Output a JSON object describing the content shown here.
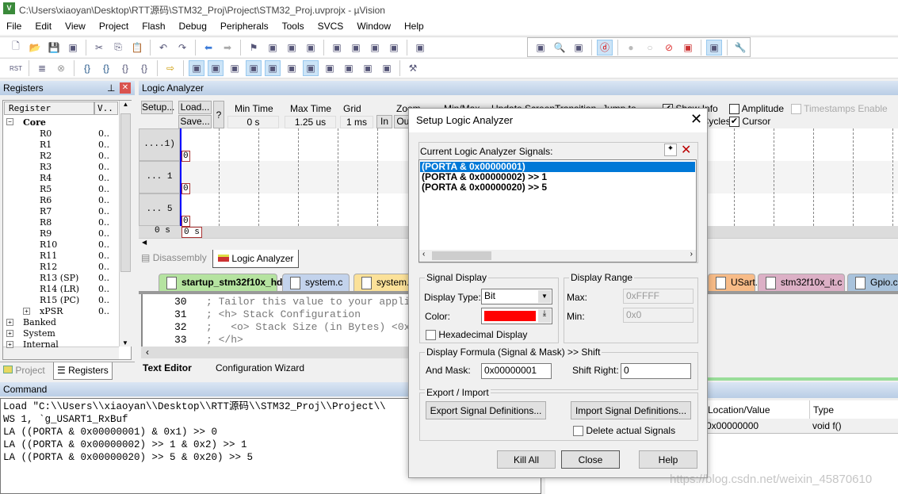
{
  "window": {
    "title": "C:\\Users\\xiaoyan\\Desktop\\RTT源码\\STM32_Proj\\Project\\STM32_Proj.uvprojx - µVision",
    "app_icon": "uvision-logo"
  },
  "menu": [
    "File",
    "Edit",
    "View",
    "Project",
    "Flash",
    "Debug",
    "Peripherals",
    "Tools",
    "SVCS",
    "Window",
    "Help"
  ],
  "toolbar1": [
    "new-file-icon",
    "open-icon",
    "save-icon",
    "save-all-icon",
    "|",
    "cut-icon",
    "copy-icon",
    "paste-icon",
    "|",
    "undo-icon",
    "redo-icon",
    "|",
    "nav-back-icon",
    "nav-forward-icon",
    "|",
    "bookmark-icon",
    "prev-bookmark-icon",
    "next-bookmark-icon",
    "clear-bookmarks-icon",
    "|",
    "indent-icon",
    "unindent-icon",
    "comment-icon",
    "uncomment-icon",
    "|",
    "find-in-files-icon"
  ],
  "toolbar1_right": [
    "find-combo-icon",
    "find-icon",
    "incremental-find-icon",
    "|",
    "debug-session-icon*",
    "|",
    "breakpoint-icon",
    "disable-breakpoint-icon",
    "kill-breakpoints-icon",
    "kill-all-icon",
    "|",
    "window-layout-icon*",
    "|",
    "configure-icon"
  ],
  "toolbar2": [
    "reset-icon",
    "|",
    "run-icon",
    "stop-icon",
    "|",
    "step-into-icon",
    "step-over-icon",
    "step-out-icon",
    "run-to-cursor-icon",
    "|",
    "show-next-statement-icon",
    "|",
    "command-window-icon*",
    "disassembly-window-icon*",
    "symbols-window-icon",
    "registers-window-icon*",
    "call-stack-window-icon*",
    "watch-window-icon",
    "memory-window-icon*",
    "serial-window-icon",
    "analysis-window-icon",
    "trace-window-icon",
    "system-viewer-icon",
    "|",
    "toolbox-icon"
  ],
  "registers": {
    "title": "Registers",
    "col_register": "Register",
    "col_value": "V..",
    "groups": {
      "core": "Core",
      "banked": "Banked",
      "system": "System",
      "internal": "Internal"
    },
    "items": [
      {
        "n": "R0",
        "v": "0.."
      },
      {
        "n": "R1",
        "v": "0.."
      },
      {
        "n": "R2",
        "v": "0.."
      },
      {
        "n": "R3",
        "v": "0.."
      },
      {
        "n": "R4",
        "v": "0.."
      },
      {
        "n": "R5",
        "v": "0.."
      },
      {
        "n": "R6",
        "v": "0.."
      },
      {
        "n": "R7",
        "v": "0.."
      },
      {
        "n": "R8",
        "v": "0.."
      },
      {
        "n": "R9",
        "v": "0.."
      },
      {
        "n": "R10",
        "v": "0.."
      },
      {
        "n": "R11",
        "v": "0.."
      },
      {
        "n": "R12",
        "v": "0.."
      },
      {
        "n": "R13 (SP)",
        "v": "0.."
      },
      {
        "n": "R14 (LR)",
        "v": "0.."
      },
      {
        "n": "R15 (PC)",
        "v": "0.."
      },
      {
        "n": "xPSR",
        "v": "0.."
      }
    ],
    "tabs": [
      "Project",
      "Registers"
    ]
  },
  "la": {
    "title": "Logic Analyzer",
    "setup": "Setup...",
    "load": "Load...",
    "save": "Save...",
    "help": "?",
    "min_time_label": "Min Time",
    "min_time": "0 s",
    "max_time_label": "Max Time",
    "max_time": "1.25 us",
    "grid_label": "Grid",
    "grid": "1 ms",
    "zoom_label": "Zoom",
    "zoom_in": "In",
    "zoom_out": "Out",
    "minmax_label": "Min/Max",
    "update_label": "Update Screen",
    "transition_label": "Transition",
    "jump_label": "Jump to",
    "show_info": "Show Info",
    "show_cycles": "Show Cycles",
    "amplitude": "Amplitude",
    "timestamps": "Timestamps Enable",
    "cursor": "Cursor",
    "signals": [
      {
        "label": "....1)",
        "value": "0"
      },
      {
        "label": "... 1",
        "value": "0"
      },
      {
        "label": "... 5",
        "value": "0"
      }
    ],
    "time_left": "0 s",
    "time_cursor": "0 s"
  },
  "view_tabs": [
    "Disassembly",
    "Logic Analyzer"
  ],
  "editor": {
    "tabs": [
      "startup_stm32f10x_hd.s",
      "system.c",
      "system.h",
      "USart.c",
      "stm32f10x_it.c",
      "Gpio.c"
    ],
    "tab_colors": [
      "#b5e3a0",
      "#c3d3ec",
      "#fbe199",
      "#f7bb87",
      "#dcb0c6",
      "#a9c3dc"
    ],
    "lines": [
      {
        "n": "30",
        "t": "; Tailor this value to your appli"
      },
      {
        "n": "31",
        "t": "; <h> Stack Configuration"
      },
      {
        "n": "32",
        "t": ";   <o> Stack Size (in Bytes) <0x"
      },
      {
        "n": "33",
        "t": "; </h>"
      }
    ],
    "bottom_tabs": [
      "Text Editor",
      "Configuration Wizard"
    ]
  },
  "command": {
    "title": "Command",
    "lines": [
      "Load \"C:\\\\Users\\\\xiaoyan\\\\Desktop\\\\RTT源码\\\\STM32_Proj\\\\Project\\\\",
      "WS 1, `g_USART1_RxBuf",
      "LA ((PORTA & 0x00000001) & 0x1) >> 0",
      "LA ((PORTA & 0x00000002) >> 1 & 0x2) >> 1",
      "LA ((PORTA & 0x00000020) >> 5 & 0x20) >> 5"
    ]
  },
  "callstack": {
    "col_location": "Location/Value",
    "col_type": "Type",
    "rows": [
      {
        "loc": "0x00000000",
        "type": "void f()"
      }
    ]
  },
  "dialog": {
    "title": "Setup Logic Analyzer",
    "signals_label": "Current Logic Analyzer Signals:",
    "signals": [
      "(PORTA & 0x00000001)",
      "(PORTA & 0x00000002) >> 1",
      "(PORTA & 0x00000020) >> 5"
    ],
    "signal_display": "Signal Display",
    "display_type_label": "Display Type:",
    "display_type": "Bit",
    "color_label": "Color:",
    "color": "#ff0000",
    "hex_display": "Hexadecimal Display",
    "display_range": "Display Range",
    "max_label": "Max:",
    "max": "0xFFFF",
    "min_label": "Min:",
    "min": "0x0",
    "formula": "Display Formula (Signal & Mask) >> Shift",
    "mask_label": "And Mask:",
    "mask": "0x00000001",
    "shift_label": "Shift Right:",
    "shift": "0",
    "export_import": "Export / Import",
    "export": "Export Signal Definitions...",
    "import": "Import Signal Definitions...",
    "delete_signals": "Delete actual Signals",
    "kill_all": "Kill All",
    "close": "Close",
    "help": "Help"
  },
  "watermark": "https://blog.csdn.net/weixin_45870610"
}
